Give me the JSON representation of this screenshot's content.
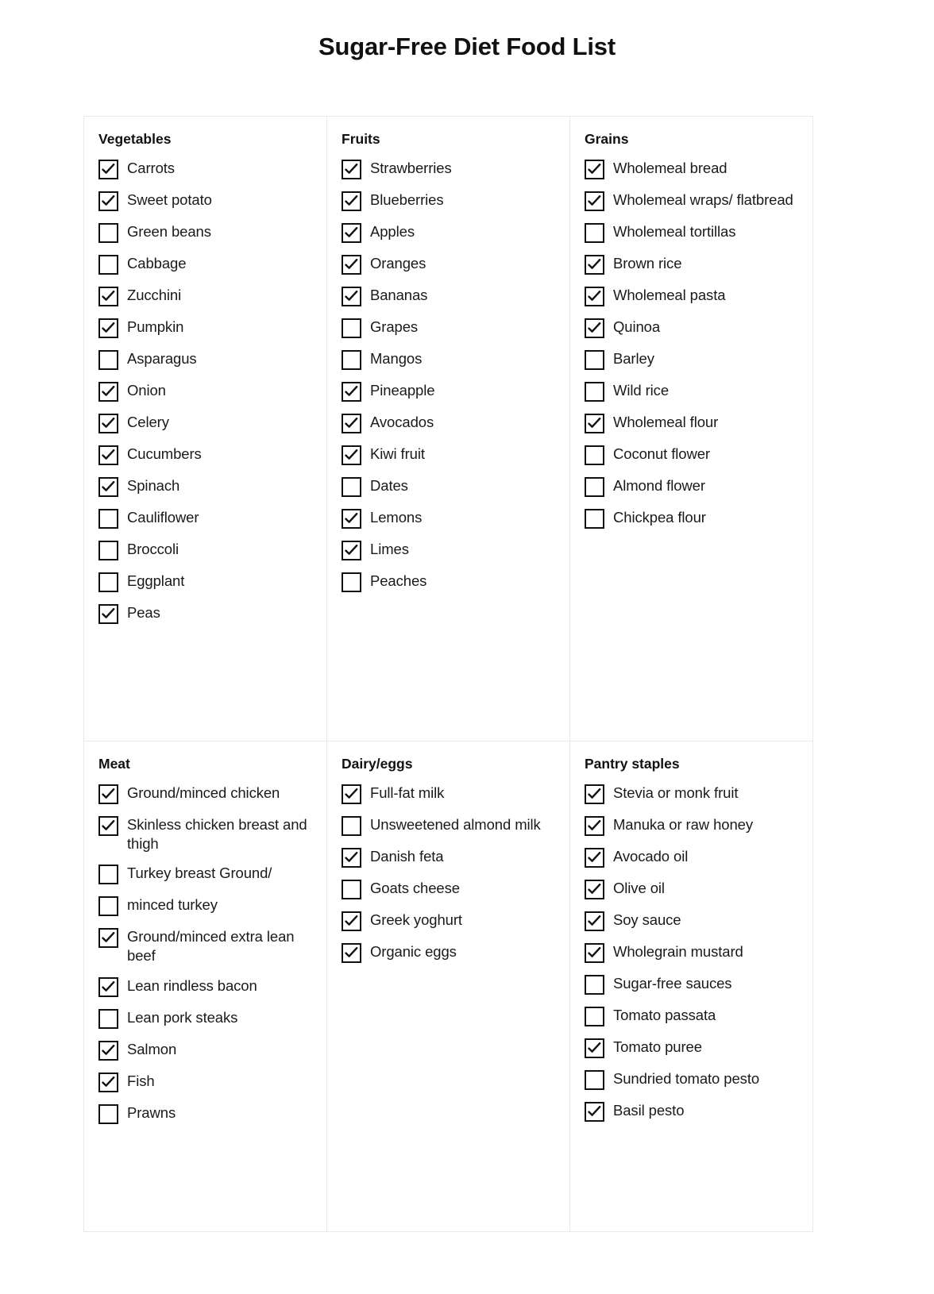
{
  "document": {
    "title": "Sugar-Free Diet Food List"
  },
  "grid": {
    "rows": [
      [
        {
          "category": "Vegetables",
          "items": [
            {
              "label": "Carrots",
              "checked": true
            },
            {
              "label": "Sweet potato",
              "checked": true
            },
            {
              "label": "Green beans",
              "checked": false
            },
            {
              "label": "Cabbage",
              "checked": false
            },
            {
              "label": "Zucchini",
              "checked": true
            },
            {
              "label": "Pumpkin",
              "checked": true
            },
            {
              "label": "Asparagus",
              "checked": false
            },
            {
              "label": "Onion",
              "checked": true
            },
            {
              "label": "Celery",
              "checked": true
            },
            {
              "label": "Cucumbers",
              "checked": true
            },
            {
              "label": "Spinach",
              "checked": true
            },
            {
              "label": "Cauliflower",
              "checked": false
            },
            {
              "label": "Broccoli",
              "checked": false
            },
            {
              "label": "Eggplant",
              "checked": false
            },
            {
              "label": "Peas",
              "checked": true
            }
          ]
        },
        {
          "category": "Fruits",
          "items": [
            {
              "label": "Strawberries",
              "checked": true
            },
            {
              "label": "Blueberries",
              "checked": true
            },
            {
              "label": "Apples",
              "checked": true
            },
            {
              "label": "Oranges",
              "checked": true
            },
            {
              "label": "Bananas",
              "checked": true
            },
            {
              "label": "Grapes",
              "checked": false
            },
            {
              "label": "Mangos",
              "checked": false
            },
            {
              "label": "Pineapple",
              "checked": true
            },
            {
              "label": "Avocados",
              "checked": true
            },
            {
              "label": "Kiwi fruit",
              "checked": true
            },
            {
              "label": "Dates",
              "checked": false
            },
            {
              "label": "Lemons",
              "checked": true
            },
            {
              "label": "Limes",
              "checked": true
            },
            {
              "label": "Peaches",
              "checked": false
            }
          ]
        },
        {
          "category": "Grains",
          "items": [
            {
              "label": "Wholemeal bread",
              "checked": true
            },
            {
              "label": "Wholemeal wraps/ flatbread",
              "checked": true
            },
            {
              "label": "Wholemeal tortillas",
              "checked": false
            },
            {
              "label": "Brown rice",
              "checked": true
            },
            {
              "label": "Wholemeal pasta",
              "checked": true
            },
            {
              "label": "Quinoa",
              "checked": true
            },
            {
              "label": "Barley",
              "checked": false
            },
            {
              "label": "Wild rice",
              "checked": false
            },
            {
              "label": "Wholemeal flour",
              "checked": true
            },
            {
              "label": "Coconut flower",
              "checked": false
            },
            {
              "label": "Almond flower",
              "checked": false
            },
            {
              "label": "Chickpea flour",
              "checked": false
            }
          ]
        }
      ],
      [
        {
          "category": "Meat",
          "items": [
            {
              "label": "Ground/minced chicken",
              "checked": true
            },
            {
              "label": "Skinless chicken breast and thigh",
              "checked": true
            },
            {
              "label": "Turkey breast Ground/",
              "checked": false
            },
            {
              "label": "minced turkey",
              "checked": false
            },
            {
              "label": "Ground/minced extra lean beef",
              "checked": true
            },
            {
              "label": "Lean rindless bacon",
              "checked": true
            },
            {
              "label": "Lean pork steaks",
              "checked": false
            },
            {
              "label": "Salmon",
              "checked": true
            },
            {
              "label": "Fish",
              "checked": true
            },
            {
              "label": "Prawns",
              "checked": false
            }
          ]
        },
        {
          "category": "Dairy/eggs",
          "items": [
            {
              "label": "Full-fat milk",
              "checked": true
            },
            {
              "label": "Unsweetened almond milk",
              "checked": false
            },
            {
              "label": "Danish feta",
              "checked": true
            },
            {
              "label": "Goats cheese",
              "checked": false
            },
            {
              "label": "Greek yoghurt",
              "checked": true
            },
            {
              "label": "Organic eggs",
              "checked": true
            }
          ]
        },
        {
          "category": "Pantry staples",
          "items": [
            {
              "label": "Stevia or monk fruit",
              "checked": true
            },
            {
              "label": "Manuka or raw honey",
              "checked": true
            },
            {
              "label": "Avocado oil",
              "checked": true
            },
            {
              "label": "Olive oil",
              "checked": true
            },
            {
              "label": "Soy sauce",
              "checked": true
            },
            {
              "label": "Wholegrain mustard",
              "checked": true
            },
            {
              "label": "Sugar-free sauces",
              "checked": false
            },
            {
              "label": "Tomato passata",
              "checked": false
            },
            {
              "label": "Tomato puree",
              "checked": true
            },
            {
              "label": "Sundried tomato pesto",
              "checked": false
            },
            {
              "label": "Basil pesto",
              "checked": true
            }
          ]
        }
      ]
    ]
  },
  "icons": {
    "checkmark": "check-icon"
  },
  "colors": {
    "text": "#1a1a1a",
    "border": "#e9e9e9",
    "checkbox_border": "#111111"
  }
}
